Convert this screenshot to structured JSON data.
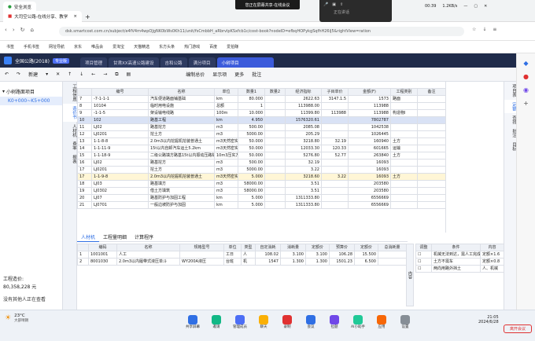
{
  "system": {
    "meeting_label": "您正在屏幕共享-在线会议",
    "meeting_sub": "正在讲话",
    "clock": "00:39",
    "net": "1.2KB/s"
  },
  "browser": {
    "tabs": [
      "安全浏览",
      "大司空公路-在线分享、教学",
      "+"
    ],
    "url": "dsk.smartcost.com.cn/subject/e4fV4m4wpOJgNK0bWs0Kh11/unit/fsCmbbH_aRbrvlpKSxfcb1c/cost-book?nodeID=efbqHOPykgSqfhH26iJ5&rightView=ration",
    "bookmarks": [
      "书签",
      "手机书签",
      "网址导航",
      "京东",
      "唯品会",
      "爱淘宝",
      "天猫精选",
      "东方头条",
      "热门游戏",
      "百度",
      "爱拍赚"
    ]
  },
  "app": {
    "product": "全国公路(2018)",
    "badge": "专业版",
    "tabs": [
      "项目管理",
      "甘肃XX高速公路建设",
      "吉和公路",
      "满分项目",
      "小树项目"
    ],
    "toolbar": [
      "撤销",
      "新建",
      "项目",
      "升级",
      "播放",
      "标准",
      "插入",
      "编制总价",
      "显示项",
      "更多",
      "批注"
    ],
    "left_vtabs": [
      "工程信息",
      "造价书",
      "人材机",
      "费率",
      "报表"
    ],
    "tree": {
      "root": "小树路面项目",
      "child": "K0+000~K5+000"
    },
    "summary": {
      "label": "工程造价:",
      "value": "80,358,228 元"
    },
    "status": "没有其他人正在查看",
    "right_vtabs": [
      "项目表",
      "定额",
      "查找",
      "批注",
      "目标"
    ],
    "bottom_tabs": [
      "人材机",
      "工程量明细",
      "计算程序"
    ]
  },
  "grid": {
    "headers": [
      "",
      "编号",
      "名称",
      "单位",
      "数量1",
      "数量2",
      "经济指标",
      "子目单价",
      "金额(F)",
      "工程类别",
      "备注"
    ],
    "rows": [
      {
        "n": "7",
        "code": "-7-1-1-1",
        "name": "汽车便道路面铺基础",
        "unit": "km",
        "q1": "80.000",
        "q2": "",
        "idx": "2622.63",
        "price": "3147.1.5",
        "amt": "1573",
        "cls": "路面",
        "note": "",
        "cls2": ""
      },
      {
        "n": "8",
        "code": "10104",
        "name": "临时用电设施",
        "unit": "总额",
        "q1": "1",
        "q2": "",
        "idx": "113988.00",
        "price": "",
        "amt": "113988",
        "cls": "",
        "note": "",
        "cls2": ""
      },
      {
        "n": "9",
        "code": "-1-1-5",
        "name": "架设输电线路",
        "unit": "100m",
        "q1": "10.000",
        "q2": "",
        "idx": "11399.80",
        "price": "113988",
        "amt": "113988",
        "cls": "构造物Ⅰ",
        "note": "",
        "cls2": ""
      },
      {
        "n": "10",
        "code": "102",
        "name": "路基工程",
        "unit": "km",
        "q1": "4.950",
        "q2": "",
        "idx": "1576320.61",
        "price": "",
        "amt": "7802787",
        "cls": "",
        "note": "",
        "cls2": "blue"
      },
      {
        "n": "11",
        "code": "LJ02",
        "name": "路基挖方",
        "unit": "m3",
        "q1": "500.00",
        "q2": "",
        "idx": "2085.08",
        "price": "",
        "amt": "1042538",
        "cls": "",
        "note": "",
        "cls2": ""
      },
      {
        "n": "12",
        "code": "LJ0201",
        "name": "挖土方",
        "unit": "m3",
        "q1": "5000.00",
        "q2": "",
        "idx": "205.29",
        "price": "",
        "amt": "1026445",
        "cls": "",
        "note": "",
        "cls2": ""
      },
      {
        "n": "13",
        "code": "1-1-8-8",
        "name": "2.0m3以内挖掘机挖装普通土",
        "unit": "m3天然密实",
        "q1": "50.000",
        "q2": "",
        "idx": "3218.80",
        "price": "32.19",
        "amt": "160940",
        "cls": "土方",
        "note": "",
        "cls2": ""
      },
      {
        "n": "14",
        "code": "1-1-11-9",
        "name": "15t以内自卸汽车运土5.2km",
        "unit": "m3天然密实",
        "q1": "50.000",
        "q2": "",
        "idx": "12033.30",
        "price": "120.33",
        "amt": "601665",
        "cls": "运输",
        "note": "",
        "cls2": ""
      },
      {
        "n": "15",
        "code": "1-1-18-9",
        "name": "二级公路填方路基15t以内振动压路机碾压土方",
        "unit": "10m3压实方",
        "q1": "50.000",
        "q2": "",
        "idx": "5276.80",
        "price": "52.77",
        "amt": "263840",
        "cls": "土方",
        "note": "",
        "cls2": ""
      },
      {
        "n": "16",
        "code": "LJ02",
        "name": "路基挖方",
        "unit": "m3",
        "q1": "500.00",
        "q2": "",
        "idx": "32.19",
        "price": "",
        "amt": "16093",
        "cls": "",
        "note": "",
        "cls2": ""
      },
      {
        "n": "17",
        "code": "LJ0201",
        "name": "挖土方",
        "unit": "m3",
        "q1": "5000.00",
        "q2": "",
        "idx": "3.22",
        "price": "",
        "amt": "16093",
        "cls": "",
        "note": "",
        "cls2": ""
      },
      {
        "n": "17",
        "code": "1-1-9-8",
        "name": "2.0m3以内挖掘机挖装普通土",
        "unit": "m3天然密实",
        "q1": "5.000",
        "q2": "",
        "idx": "3218.60",
        "price": "3.22",
        "amt": "16093",
        "cls": "土方",
        "note": "",
        "cls2": "sel"
      },
      {
        "n": "18",
        "code": "LJ03",
        "name": "路基填方",
        "unit": "m3",
        "q1": "58000.00",
        "q2": "",
        "idx": "3.51",
        "price": "",
        "amt": "203580",
        "cls": "",
        "note": "",
        "cls2": ""
      },
      {
        "n": "19",
        "code": "LJ0302",
        "name": "借土方填筑",
        "unit": "m3",
        "q1": "58000.00",
        "q2": "",
        "idx": "3.51",
        "price": "",
        "amt": "203580",
        "cls": "",
        "note": "",
        "cls2": ""
      },
      {
        "n": "20",
        "code": "LJ07",
        "name": "路基防护与加固工程",
        "unit": "km",
        "q1": "5.000",
        "q2": "",
        "idx": "1311333.80",
        "price": "",
        "amt": "6556669",
        "cls": "",
        "note": "",
        "cls2": ""
      },
      {
        "n": "21",
        "code": "LJ0701",
        "name": "一般边坡防护与加固",
        "unit": "km",
        "q1": "5.000",
        "q2": "",
        "idx": "1311333.80",
        "price": "",
        "amt": "6556669",
        "cls": "",
        "note": "",
        "cls2": ""
      }
    ]
  },
  "sub_grid": {
    "headers": [
      "",
      "编码",
      "名称",
      "规格型号",
      "单位",
      "类型",
      "自定消耗",
      "消耗量",
      "定额价",
      "预算价",
      "定额价",
      "总消耗量"
    ],
    "rows": [
      [
        "1",
        "1001001",
        "人工",
        "",
        "工日",
        "人",
        "108.02",
        "3.100",
        "3.100",
        "106.28",
        "15.500"
      ],
      [
        "2",
        "8001030",
        "2.0m3以内履带式液压单斗",
        "WY200A液压",
        "台班",
        "机",
        "1547",
        "1.300",
        "1.300",
        "1501.23",
        "6.500"
      ]
    ]
  },
  "right_table": {
    "headers": [
      "调整",
      "条件",
      "内容"
    ],
    "rows": [
      [
        "",
        "机械无法到达，需人工完成",
        "定额×1.6"
      ],
      [
        "",
        "土方不需车",
        "定额×0.8"
      ],
      [
        "",
        "两向用路外挡土",
        "人、机械"
      ]
    ]
  },
  "taskbar": {
    "weather": "23°C",
    "weather_sub": "大部晴朗",
    "apps": [
      "共享屏幕",
      "邀请",
      "管理成员",
      "聊天",
      "录制",
      "会议",
      "拉题",
      "AI小助手",
      "应用",
      "设置"
    ],
    "time": "21:05",
    "date": "2024/6/28",
    "end": "离开会议"
  }
}
